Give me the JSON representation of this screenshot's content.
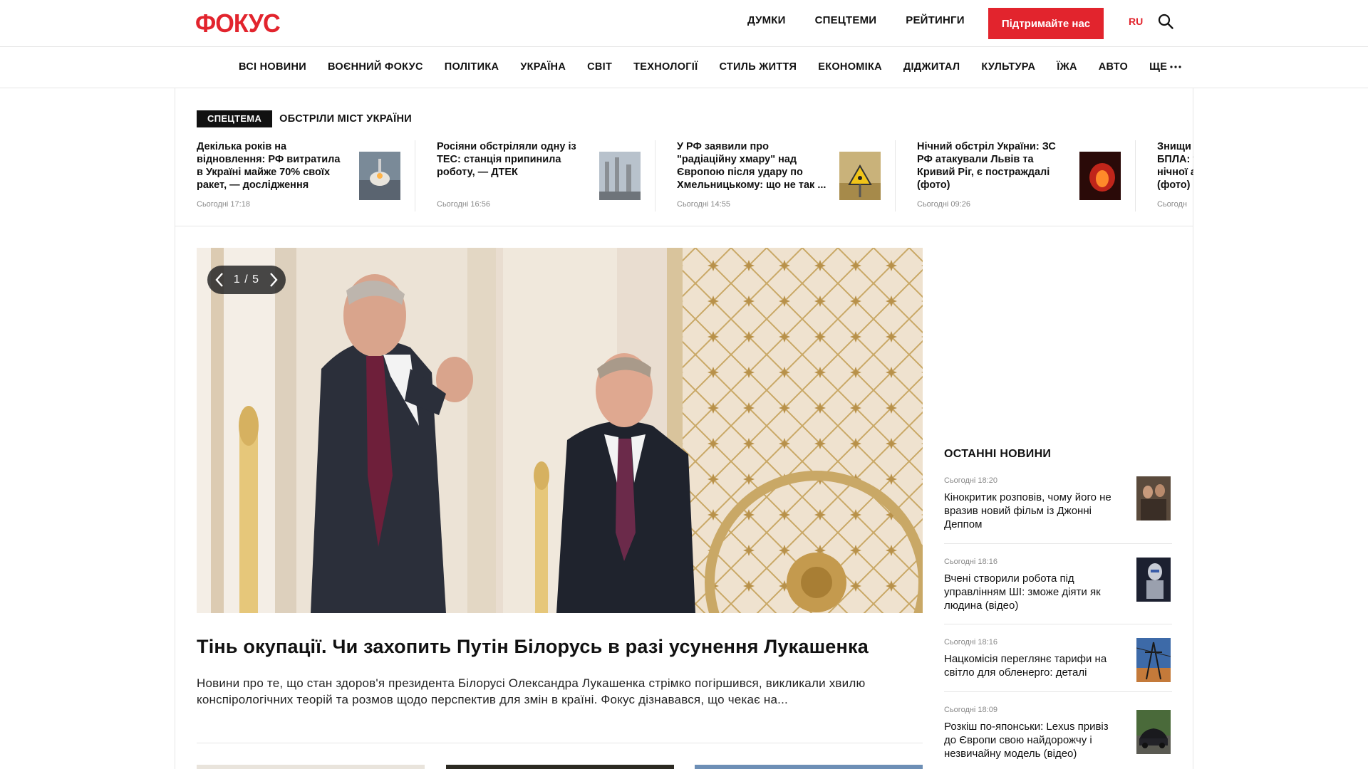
{
  "header": {
    "logo": "ФОКУС",
    "top_links": [
      "ДУМКИ",
      "СПЕЦТЕМИ",
      "РЕЙТИНГИ"
    ],
    "support_label": "Підтримайте нас",
    "lang": "RU"
  },
  "categories": {
    "items": [
      "ВСІ НОВИНИ",
      "ВОЄННИЙ ФОКУС",
      "ПОЛІТИКА",
      "УКРАЇНА",
      "СВІТ",
      "ТЕХНОЛОГІЇ",
      "СТИЛЬ ЖИТТЯ",
      "ЕКОНОМІКА",
      "ДІДЖИТАЛ",
      "КУЛЬТУРА",
      "ЇЖА",
      "АВТО"
    ],
    "more_label": "ЩЕ"
  },
  "special": {
    "badge": "СПЕЦТЕМА",
    "title": "ОБСТРІЛИ МІСТ УКРАЇНИ"
  },
  "ticker": [
    {
      "text": "Декілька років на відновлення: РФ витратила в Україні майже 70% своїх ракет, — дослідження",
      "time": "Сьогодні 17:18"
    },
    {
      "text": "Росіяни обстріляли одну із ТЕС: станція припинила роботу, — ДТЕК",
      "time": "Сьогодні 16:56"
    },
    {
      "text": "У РФ заявили про \"радіаційну хмару\" над Європою після удару по Хмельницькому: що не так ...",
      "time": "Сьогодні 14:55"
    },
    {
      "text": "Нічний обстріл України: ЗС РФ атакували Львів та Кривий Ріг, є постраждалі (фото)",
      "time": "Сьогодні 09:26"
    },
    {
      "text": "Знищи БПЛА: у нічної а (фото)",
      "time": "Сьогодн"
    }
  ],
  "hero": {
    "slide_counter": "1 / 5",
    "title": "Тінь окупації. Чи захопить Путін Білорусь в разі усунення Лукашенка",
    "lead": "Новини про те, що стан здоров'я президента Білорусі Олександра Лукашенка стрімко погіршився, викликали хвилю конспірологічних теорій та розмов щодо перспектив для змін в країні. Фокус дізнавався, що чекає на..."
  },
  "sidebar": {
    "title": "ОСТАННІ НОВИНИ",
    "items": [
      {
        "time": "Сьогодні 18:20",
        "text": "Кінокритик розповів, чому його не вразив новий фільм із Джонні Деппом"
      },
      {
        "time": "Сьогодні 18:16",
        "text": "Вчені створили робота під управлінням ШІ: зможе діяти як людина (відео)"
      },
      {
        "time": "Сьогодні 18:16",
        "text": "Нацкомісія переглянє тарифи на світло для обленерго: деталі"
      },
      {
        "time": "Сьогодні 18:09",
        "text": "Розкіш по-японськи: Lexus привіз до Європи свою найдорожчу і незвичайну модель (відео)"
      }
    ]
  },
  "colors": {
    "accent": "#e2242d",
    "text": "#111111",
    "muted": "#888888",
    "border": "#e6e6e6"
  }
}
